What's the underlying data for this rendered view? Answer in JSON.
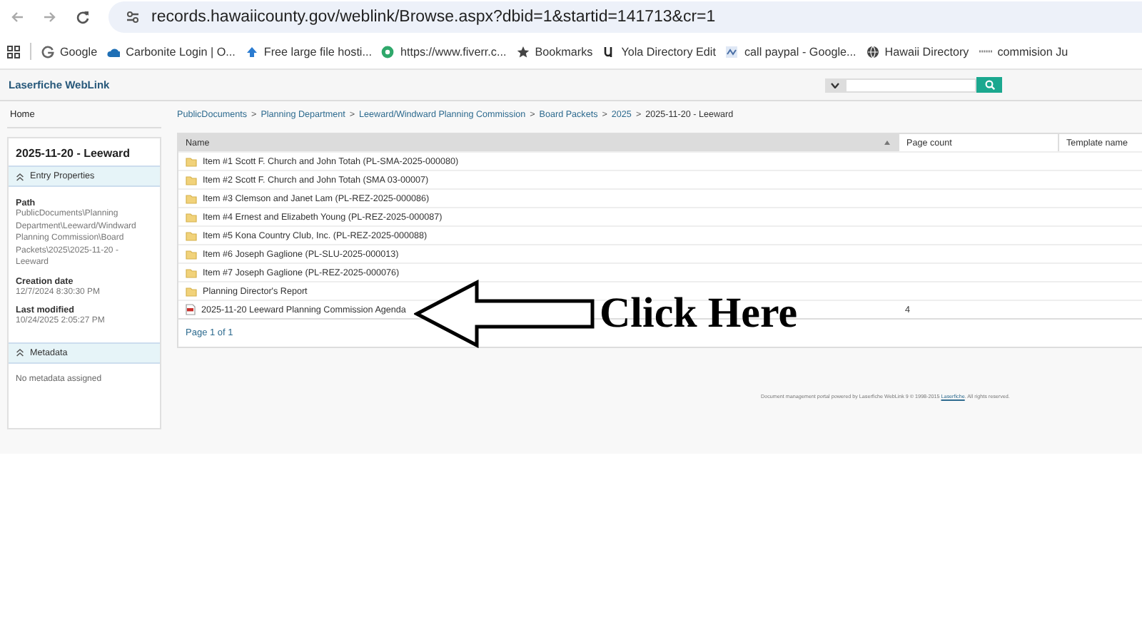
{
  "browser": {
    "url": "records.hawaiicounty.gov/weblink/Browse.aspx?dbid=1&startid=141713&cr=1",
    "bookmarks": [
      {
        "kind": "google",
        "label": "Google"
      },
      {
        "kind": "cloud",
        "label": "Carbonite Login | O..."
      },
      {
        "kind": "upload",
        "label": "Free large file hosti..."
      },
      {
        "kind": "site",
        "label": "https://www.fiverr.c..."
      },
      {
        "kind": "star",
        "label": "Bookmarks"
      },
      {
        "kind": "letter",
        "label": "Yola Directory Edit"
      },
      {
        "kind": "badge",
        "label": "call paypal - Google..."
      },
      {
        "kind": "globe",
        "label": "Hawaii Directory"
      },
      {
        "kind": "logo",
        "label": "commision Ju"
      }
    ]
  },
  "app": {
    "brand": "Laserfiche WebLink",
    "home": "Home"
  },
  "sidebar": {
    "title": "2025-11-20 - Leeward",
    "sections": [
      {
        "kind": "properties",
        "title": "Entry Properties",
        "expanded": true,
        "fields": [
          {
            "label": "Path",
            "value": "PublicDocuments\\Planning Department\\Leeward/Windward Planning Commission\\Board Packets\\2025\\2025-11-20 - Leeward"
          },
          {
            "label": "Creation date",
            "value": "12/7/2024 8:30:30 PM"
          },
          {
            "label": "Last modified",
            "value": "10/24/2025 2:05:27 PM"
          }
        ]
      },
      {
        "kind": "note",
        "title": "Metadata",
        "expanded": true,
        "text": "No metadata assigned"
      }
    ]
  },
  "breadcrumbs": {
    "separator": ">",
    "items": [
      {
        "label": "PublicDocuments",
        "link": true
      },
      {
        "label": "Planning Department",
        "link": true
      },
      {
        "label": "Leeward/Windward Planning Commission",
        "link": true
      },
      {
        "label": "Board Packets",
        "link": true
      },
      {
        "label": "2025",
        "link": true
      },
      {
        "label": "2025-11-20 - Leeward",
        "link": false
      }
    ]
  },
  "table": {
    "columns": [
      {
        "label": "Name",
        "sorted": true
      },
      {
        "label": "Page count",
        "sorted": false
      },
      {
        "label": "Template name",
        "sorted": false
      }
    ],
    "rows": [
      {
        "kind": "folder",
        "name": "Item #1 Scott F. Church and John Totah (PL-SMA-2025-000080)"
      },
      {
        "kind": "folder",
        "name": "Item #2 Scott F. Church and John Totah (SMA 03-00007)"
      },
      {
        "kind": "folder",
        "name": "Item #3 Clemson and Janet Lam (PL-REZ-2025-000086)"
      },
      {
        "kind": "folder",
        "name": "Item #4 Ernest and Elizabeth Young (PL-REZ-2025-000087)"
      },
      {
        "kind": "folder",
        "name": "Item #5 Kona Country Club, Inc. (PL-REZ-2025-000088)"
      },
      {
        "kind": "folder",
        "name": "Item #6 Joseph Gaglione (PL-SLU-2025-000013)"
      },
      {
        "kind": "folder",
        "name": "Item #7 Joseph Gaglione (PL-REZ-2025-000076)"
      },
      {
        "kind": "folder",
        "name": "Planning Director's Report"
      },
      {
        "kind": "pdf",
        "name": "2025-11-20 Leeward Planning Commission Agenda",
        "page_count": "4"
      }
    ],
    "pager": "Page 1 of 1"
  },
  "footer": {
    "text": "Document management portal powered by Laserfiche WebLink 9 © 1998-2015 ",
    "link": "Laserfiche",
    "after": ". All rights reserved."
  },
  "annotation": {
    "text": "Click Here"
  }
}
